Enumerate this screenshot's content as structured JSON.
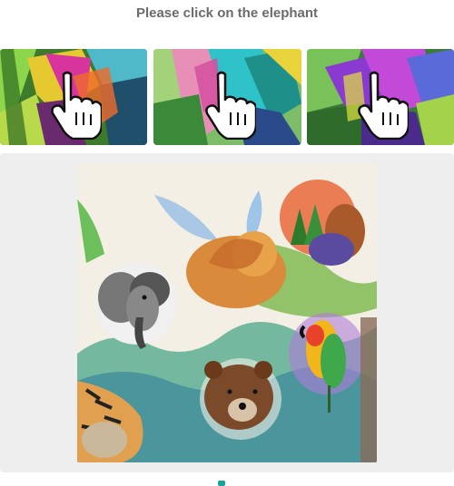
{
  "prompt": "Please click on the elephant",
  "examples": [
    {
      "icon": "hand-pointer-icon"
    },
    {
      "icon": "hand-pointer-icon"
    },
    {
      "icon": "hand-pointer-icon"
    }
  ],
  "colors": {
    "prompt_text": "#6b6b6b",
    "panel_bg": "#eeeeee",
    "accent": "#1aa39a"
  }
}
